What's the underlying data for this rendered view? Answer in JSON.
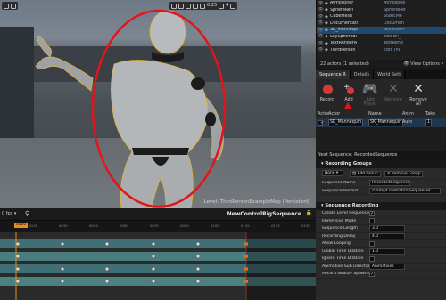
{
  "viewport": {
    "toolbar_right": "0.25",
    "toolbar_num": "4",
    "level_label": "Level:  ThirdPersonExampleMap (Persistent)"
  },
  "outliner": {
    "rows": [
      {
        "label": "Atmospher",
        "type": "Atmosphe",
        "selected": false
      },
      {
        "label": "SphereRefl",
        "type": "SphereRef",
        "selected": false
      },
      {
        "label": "CubeMesh",
        "type": "StaticMe",
        "selected": false
      },
      {
        "label": "Documentati",
        "type": "Documen",
        "selected": false
      },
      {
        "label": "SK_Mannequ",
        "type": "SkeletalM",
        "selected": true
      },
      {
        "label": "SkySphereBl",
        "type": "Edit BP_",
        "selected": false
      },
      {
        "label": "TextRenderA",
        "type": "TextRend",
        "selected": false
      },
      {
        "label": "ThirdPerson",
        "type": "Edit Thi",
        "selected": false
      }
    ],
    "status": "22 actors (1 selected)",
    "view_options": "View Options"
  },
  "recorder": {
    "tabs": [
      "Sequence R",
      "Details",
      "World Sett"
    ],
    "buttons": [
      "Record",
      "Add",
      "Add Player",
      "Remove",
      "Remove All"
    ],
    "table_headers": [
      "Actor",
      "Actor",
      "Name",
      "Anim",
      "Take"
    ],
    "row": {
      "actor": "SK_Mannequin",
      "name": "SK_Mannequin",
      "anim": "Auto",
      "take": "1"
    },
    "next_sequence": "Next Sequence: RecordedSequence"
  },
  "groups": {
    "section_label": "Recording Groups",
    "none_label": "None",
    "add_group": "Add Group",
    "remove_group": "Remove Group",
    "sequence_name_label": "Sequence Name",
    "sequence_name": "RecordedSequence",
    "sequence_recording_label": "Sequence Record",
    "sequence_recording_path": "/Game/Cinematics/Sequences"
  },
  "seq_recording": {
    "section_label": "Sequence Recording",
    "props": [
      {
        "k": "Create Level Sequence",
        "type": "chk",
        "on": true
      },
      {
        "k": "Immersive Mode",
        "type": "chk",
        "on": false
      },
      {
        "k": "Sequence Length",
        "type": "fld",
        "v": "3.0"
      },
      {
        "k": "Recording Delay",
        "type": "fld",
        "v": "4.0"
      },
      {
        "k": "Allow Looping",
        "type": "chk",
        "on": false
      },
      {
        "k": "Global Time Dilation",
        "type": "fld",
        "v": "1.0"
      },
      {
        "k": "Ignore Time Dilation",
        "type": "chk",
        "on": false
      },
      {
        "k": "Animation Sub Directory",
        "type": "fld",
        "v": "Animations"
      },
      {
        "k": "Record Nearby Spawned A",
        "type": "chk",
        "on": true
      }
    ]
  },
  "sequencer": {
    "fps": "0 fps",
    "title": "NewControlRigSequence",
    "current_frame": "0000",
    "ticks": [
      "0015",
      "0030",
      "0045",
      "0060",
      "0075",
      "0090",
      "0105",
      "0120",
      "0135",
      "0150"
    ]
  },
  "colors": {
    "accent": "#e88c1a",
    "selection": "#1f4a6e",
    "annotation_red": "#e0161a",
    "character_outline": "#e2b23a"
  }
}
